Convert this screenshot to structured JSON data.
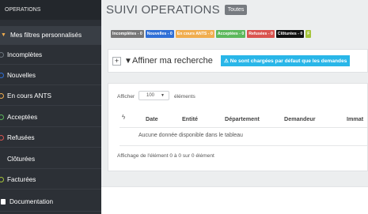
{
  "sidebar": {
    "header": "OPERATIONS",
    "items": [
      {
        "label": "Mes filtres personnalisés",
        "icon": "chevron-down-icon",
        "color": "#f0ad4e"
      },
      {
        "label": "Incomplètes",
        "icon": "circle-icon",
        "color": "#6c757d"
      },
      {
        "label": "Nouvelles",
        "icon": "circle-icon",
        "color": "#2f6fd6"
      },
      {
        "label": "En cours ANTS",
        "icon": "circle-icon",
        "color": "#f0ad4e"
      },
      {
        "label": "Acceptées",
        "icon": "circle-icon",
        "color": "#5cb85c"
      },
      {
        "label": "Refusées",
        "icon": "circle-icon",
        "color": "#d9534f"
      },
      {
        "label": "Clôturées",
        "icon": "circle-icon",
        "color": "#000000"
      },
      {
        "label": "Facturées",
        "icon": "circle-icon",
        "color": "#a5c43a"
      },
      {
        "label": "Documentation",
        "icon": "book-icon",
        "color": "#ffffff"
      }
    ]
  },
  "page": {
    "title": "SUIVI OPERATIONS",
    "title_tag": "Toutes"
  },
  "badges": [
    {
      "label": "Incomplètes - 0",
      "color": "#777777"
    },
    {
      "label": "Nouvelles - 0",
      "color": "#2f6fd6"
    },
    {
      "label": "En cours ANTS - 0",
      "color": "#f0ad4e"
    },
    {
      "label": "Acceptées - 0",
      "color": "#5cb85c"
    },
    {
      "label": "Refusées - 0",
      "color": "#d9534f"
    },
    {
      "label": "Clôturées - 0",
      "color": "#111111"
    },
    {
      "label": "F",
      "color": "#a5c43a"
    }
  ],
  "filter": {
    "plus": "+",
    "label": "Affiner ma recherche",
    "info": "⚠ Ne sont chargées par défaut que les demandes"
  },
  "table": {
    "show_label": "Afficher",
    "page_size": "100",
    "elements_label": "éléments",
    "columns": [
      "Date",
      "Entité",
      "Département",
      "Demandeur",
      "Immat"
    ],
    "empty_text": "Aucune donnée disponible dans le tableau",
    "count_text": "Affichage de l'élément 0 à 0 sur 0 élément"
  }
}
